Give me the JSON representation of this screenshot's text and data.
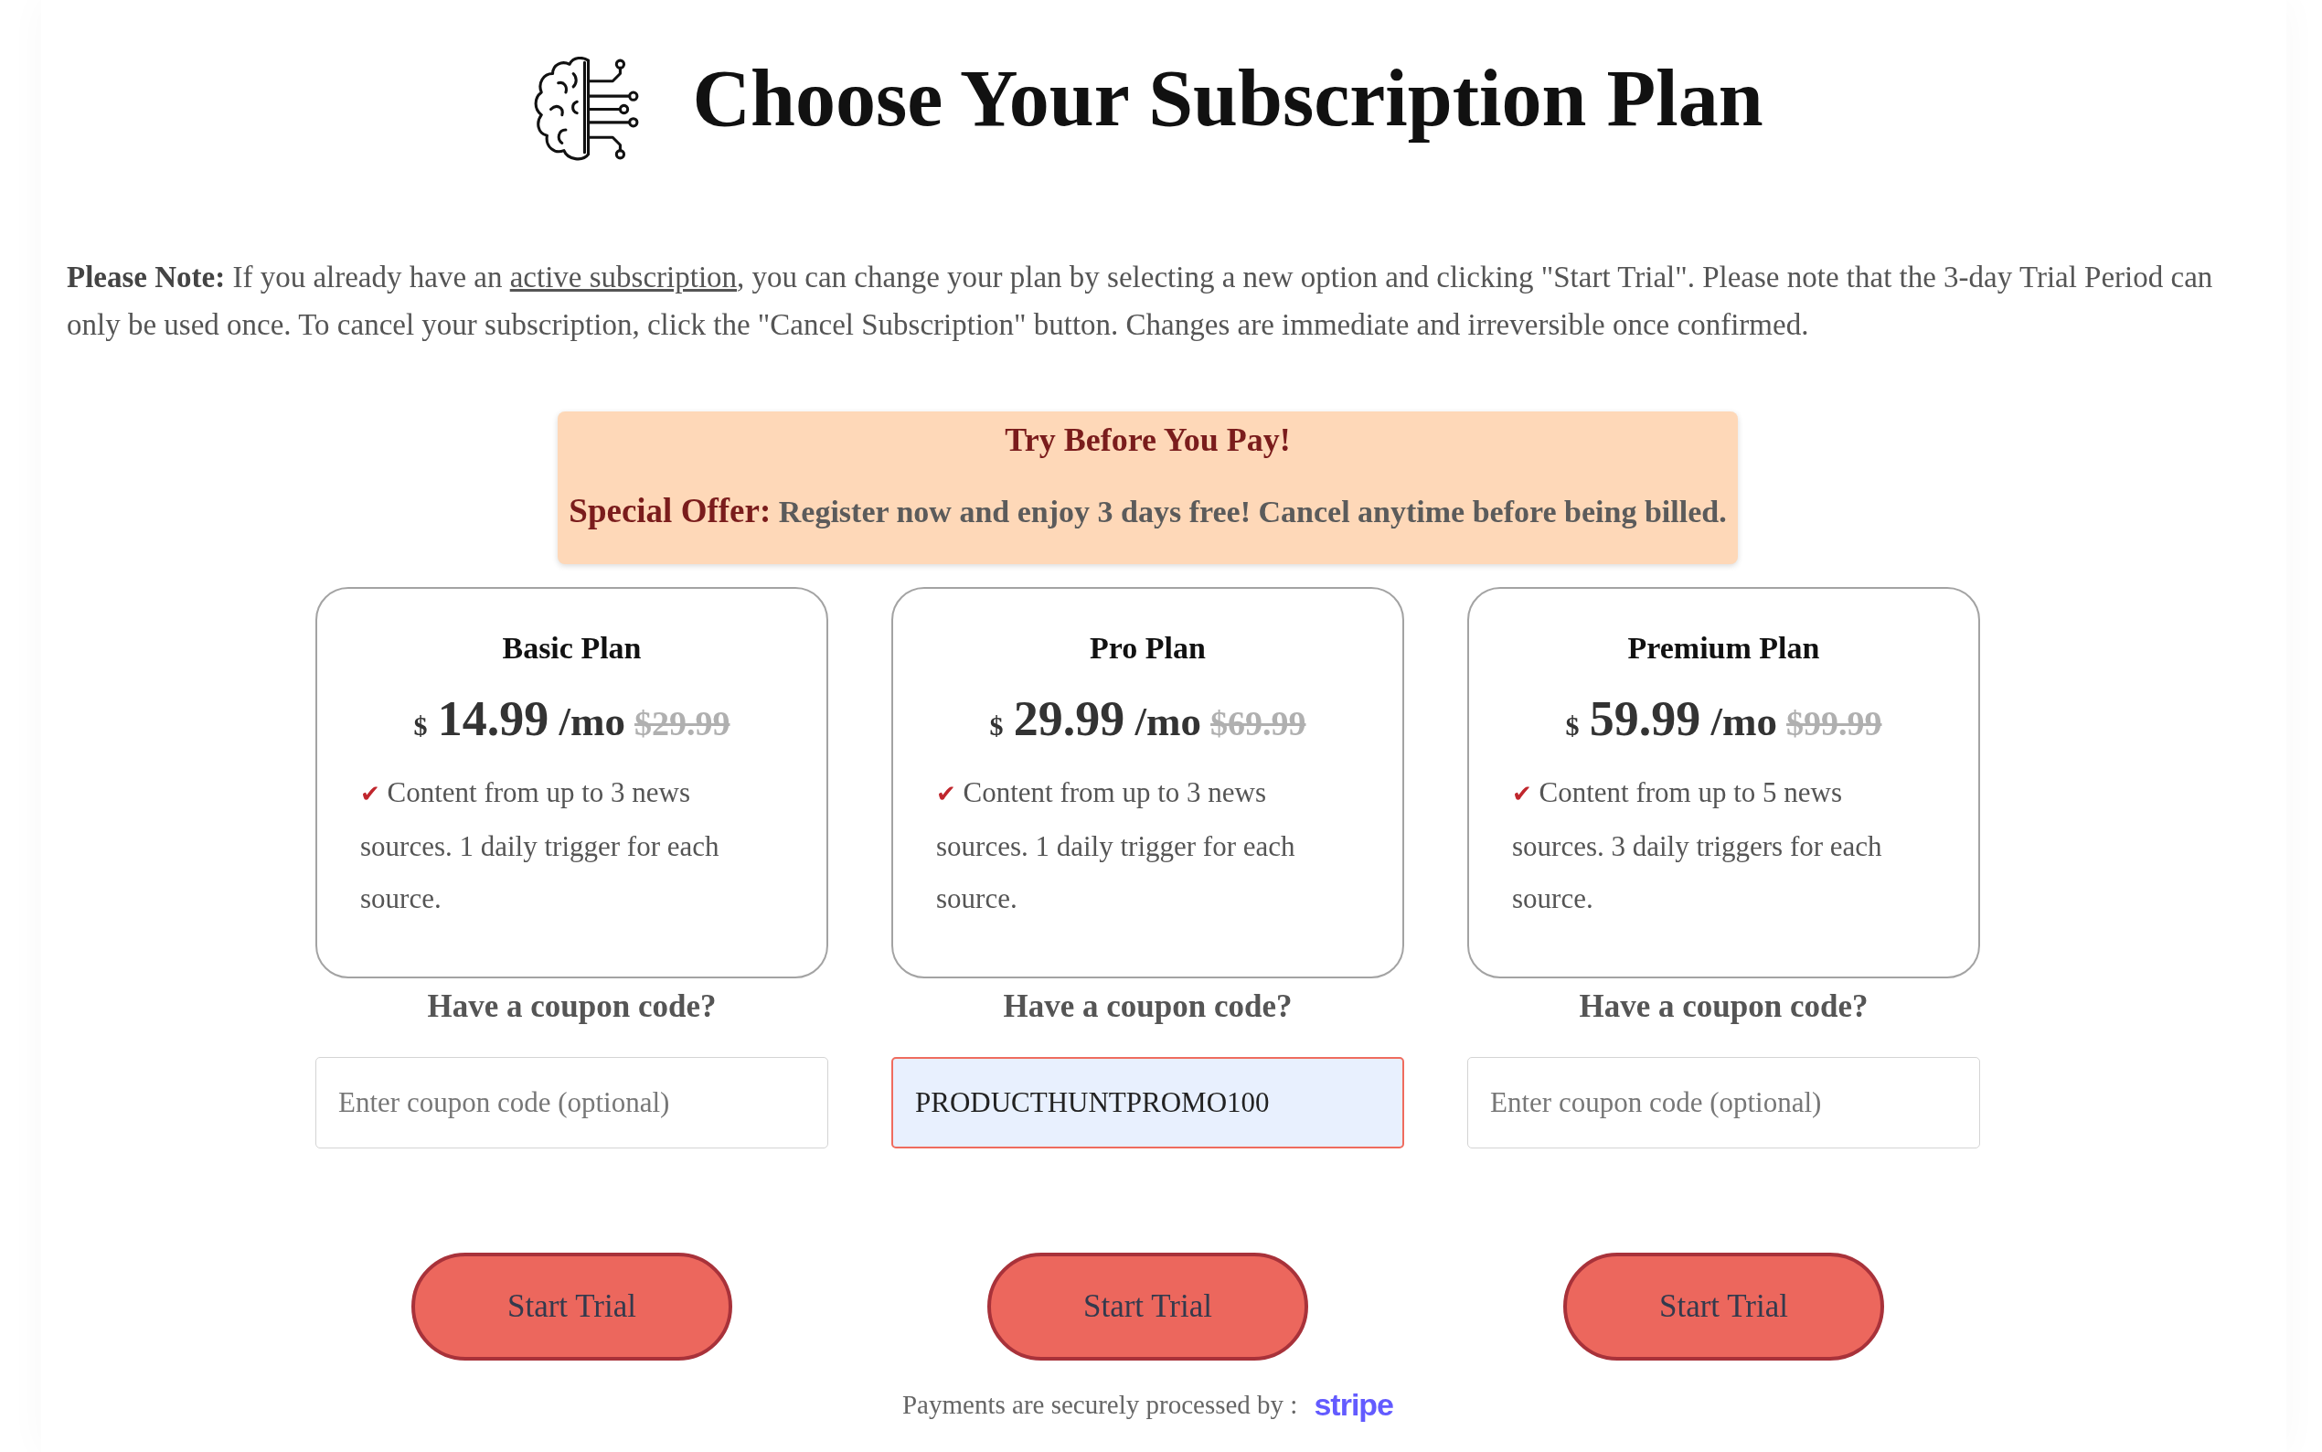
{
  "header": {
    "title": "Choose Your Subscription Plan"
  },
  "note": {
    "text": "**Please Note:** If you already have an ",
    "link": "active subscription",
    "text_after": ", you can change your plan by selecting a new option and clicking \"Start Trial\". Please note that the 3-day Trial Period can only be used once. To cancel your subscription, click the \"Cancel Subscription\" button. Changes are immediate and irreversible once confirmed."
  },
  "offer": {
    "title": "Try Before You Pay!",
    "label": "Special Offer:",
    "text": "Register now and enjoy 3 days free! Cancel anytime before being billed."
  },
  "plans": [
    {
      "name": "Basic Plan",
      "currency": "$",
      "price": "14.99",
      "period": "/mo",
      "old_price": "$29.99",
      "features": [
        {
          "icon": "✔",
          "text": "Content from up to 3 news sources. 1 daily trigger for each source."
        }
      ],
      "coupon_label": "Have a coupon code?",
      "coupon": {
        "placeholder": "Enter coupon code (optional)",
        "focused": false
      },
      "button": "Start Trial"
    },
    {
      "name": "Pro Plan",
      "currency": "$",
      "price": "29.99",
      "period": "/mo",
      "old_price": "$69.99",
      "features": [
        {
          "icon": "✔",
          "text": "Content from up to 3 news sources. 1 daily trigger for each source."
        }
      ],
      "coupon_label": "Have a coupon code?",
      "coupon": {
        "value": "PRODUCTHUNTPROMO100",
        "focused": true
      },
      "button": "Start Trial"
    },
    {
      "name": "Premium Plan",
      "currency": "$",
      "price": "59.99",
      "period": "/mo",
      "old_price": "$99.99",
      "features": [
        {
          "icon": "✔",
          "text": "Content from up to 5 news sources. 3 daily triggers for each source."
        }
      ],
      "coupon_label": "Have a coupon code?",
      "coupon": {
        "placeholder": "Enter coupon code (optional)",
        "focused": false
      },
      "button": "Start Trial"
    }
  ],
  "footer": {
    "text": "Payments are securely processed by :",
    "logo": "stripe"
  }
}
